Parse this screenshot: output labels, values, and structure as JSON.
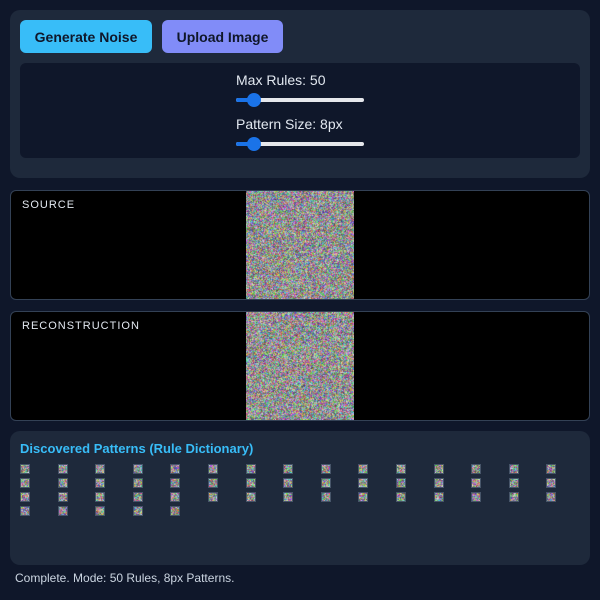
{
  "controls": {
    "generate_label": "Generate Noise",
    "upload_label": "Upload Image",
    "max_rules": {
      "label": "Max Rules: 50",
      "value": 50,
      "min": 1,
      "max": 500
    },
    "pattern_size": {
      "label": "Pattern Size: 8px",
      "value": 8,
      "min": 2,
      "max": 64
    }
  },
  "source": {
    "label": "SOURCE"
  },
  "reconstruction": {
    "label": "RECONSTRUCTION"
  },
  "patterns": {
    "title": "Discovered Patterns (Rule Dictionary)",
    "count": 50
  },
  "status": "Complete. Mode: 50 Rules, 8px Patterns."
}
